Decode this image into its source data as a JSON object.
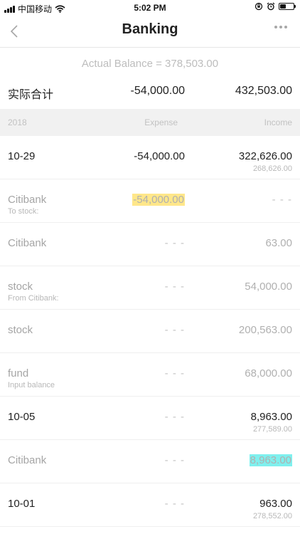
{
  "status_bar": {
    "carrier": "中国移动",
    "time": "5:02 PM",
    "battery_level": 0.45
  },
  "nav": {
    "title": "Banking"
  },
  "summary": {
    "actual_balance": "Actual Balance = 378,503.00",
    "label": "实际合计",
    "expense": "-54,000.00",
    "income": "432,503.00"
  },
  "section_header": {
    "year": "2018",
    "expense": "Expense",
    "income": "Income"
  },
  "rows": [
    {
      "type": "date",
      "label": "10-29",
      "sublabel": "",
      "expense": "-54,000.00",
      "income": "322,626.00",
      "balance": "268,626.00"
    },
    {
      "type": "detail",
      "label": "Citibank",
      "sublabel": "To stock:",
      "expense": "-54,000.00",
      "income": "- - -",
      "balance": "",
      "highlight_expense": "yellow"
    },
    {
      "type": "detail",
      "label": "Citibank",
      "sublabel": "",
      "expense": "- - -",
      "income": "63.00",
      "balance": ""
    },
    {
      "type": "detail",
      "label": "stock",
      "sublabel": "From Citibank:",
      "expense": "- - -",
      "income": "54,000.00",
      "balance": ""
    },
    {
      "type": "detail",
      "label": "stock",
      "sublabel": "",
      "expense": "- - -",
      "income": "200,563.00",
      "balance": ""
    },
    {
      "type": "detail",
      "label": "fund",
      "sublabel": "Input balance",
      "expense": "- - -",
      "income": "68,000.00",
      "balance": ""
    },
    {
      "type": "date",
      "label": "10-05",
      "sublabel": "",
      "expense": "- - -",
      "income": "8,963.00",
      "balance": "277,589.00"
    },
    {
      "type": "detail",
      "label": "Citibank",
      "sublabel": "",
      "expense": "- - -",
      "income": "8,963.00",
      "balance": "",
      "highlight_income": "cyan"
    },
    {
      "type": "date",
      "label": "10-01",
      "sublabel": "",
      "expense": "- - -",
      "income": "963.00",
      "balance": "278,552.00"
    }
  ],
  "colors": {
    "highlight_yellow": "#ffe78a",
    "highlight_cyan": "#7ff0ee",
    "section_bg": "#f1f1f1"
  },
  "icons": {
    "back": "chevron-left-icon",
    "more": "more-dots-icon",
    "wifi": "wifi-icon",
    "battery": "battery-icon",
    "alarm": "alarm-icon",
    "rotation_lock": "rotation-lock-icon"
  }
}
